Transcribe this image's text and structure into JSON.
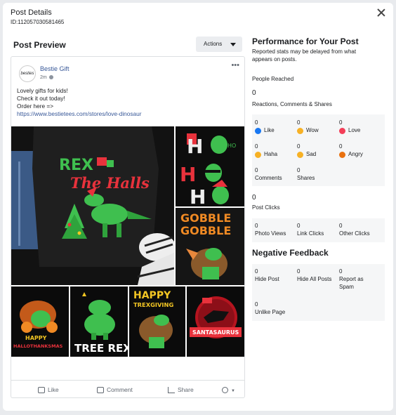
{
  "header": {
    "title": "Post Details",
    "id_label": "ID:112057030581465"
  },
  "preview": {
    "title": "Post Preview",
    "actions_label": "Actions",
    "page_name": "Bestie Gift",
    "avatar_text": "besties",
    "time": "2m",
    "text_lines": [
      "Lovely gifts for kids!",
      "Check it out today!",
      "Order here =>"
    ],
    "link": "https://www.bestietees.com/stores/love-dinosaur",
    "images": {
      "main": {
        "line1": "REX",
        "line2": "The Halls"
      },
      "ho": "HO",
      "gobble": {
        "line1": "GOBBLE",
        "line2": "GOBBLE"
      },
      "hallo": {
        "line1": "HAPPY",
        "line2": "HALLOTHANKSMAS"
      },
      "treerex": "TREE REX",
      "trexgiving": {
        "line1": "HAPPY",
        "line2": "TREXGIVING"
      },
      "santa": "SANTASAURUS"
    },
    "like": "Like",
    "comment": "Comment",
    "share": "Share"
  },
  "performance": {
    "title": "Performance for Your Post",
    "subtitle": "Reported stats may be delayed from what appears on posts.",
    "people_reached_label": "People Reached",
    "people_reached": "0",
    "reactions_label": "Reactions, Comments & Shares",
    "reactions_total": "0",
    "reactions": [
      {
        "value": "0",
        "label": "Like",
        "color": "#1877f2"
      },
      {
        "value": "0",
        "label": "Wow",
        "color": "#f7b125"
      },
      {
        "value": "0",
        "label": "Love",
        "color": "#f33e58"
      },
      {
        "value": "0",
        "label": "Haha",
        "color": "#f7b125"
      },
      {
        "value": "0",
        "label": "Sad",
        "color": "#f7b125"
      },
      {
        "value": "0",
        "label": "Angry",
        "color": "#e9710f"
      }
    ],
    "comments": {
      "value": "0",
      "label": "Comments"
    },
    "shares": {
      "value": "0",
      "label": "Shares"
    },
    "post_clicks_total": "0",
    "post_clicks_label": "Post Clicks",
    "clicks": [
      {
        "value": "0",
        "label": "Photo Views"
      },
      {
        "value": "0",
        "label": "Link Clicks"
      },
      {
        "value": "0",
        "label": "Other Clicks"
      }
    ],
    "negative_title": "Negative Feedback",
    "negative": [
      {
        "value": "0",
        "label": "Hide Post"
      },
      {
        "value": "0",
        "label": "Hide All Posts"
      },
      {
        "value": "0",
        "label": "Report as Spam"
      },
      {
        "value": "0",
        "label": "Unlike Page"
      }
    ]
  }
}
